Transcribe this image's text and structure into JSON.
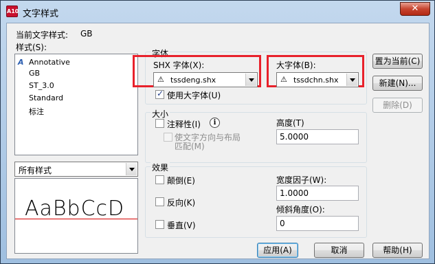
{
  "window": {
    "title": "文字样式",
    "app_icon_text": "A10",
    "close_glyph": "✕"
  },
  "current_style": {
    "label": "当前文字样式:",
    "value": "GB"
  },
  "styles": {
    "label": "样式(S):",
    "items": [
      {
        "icon": "A",
        "label": "Annotative"
      },
      {
        "label": "GB"
      },
      {
        "label": "ST_3.0"
      },
      {
        "label": "Standard"
      },
      {
        "label": "标注"
      }
    ],
    "filter": "所有样式"
  },
  "preview_text": "AaBbCcD",
  "font": {
    "group_title": "字体",
    "shx_label": "SHX 字体(X):",
    "shx_value": "tssdeng.shx",
    "big_label": "大字体(B):",
    "big_value": "tssdchn.shx",
    "use_big_font": "使用大字体(U)",
    "use_big_font_checked": true
  },
  "size": {
    "group_title": "大小",
    "annotative": "注释性(I)",
    "annotative_checked": false,
    "match_orientation_line1": "使文字方向与布局",
    "match_orientation_line2": "匹配(M)",
    "height_label": "高度(T)",
    "height_value": "5.0000"
  },
  "effects": {
    "group_title": "效果",
    "upside_down": "颠倒(E)",
    "backwards": "反向(K)",
    "vertical": "垂直(V)",
    "width_label": "宽度因子(W):",
    "width_value": "1.0000",
    "oblique_label": "倾斜角度(O):",
    "oblique_value": "0"
  },
  "buttons": {
    "set_current": "置为当前(C)",
    "new": "新建(N)...",
    "delete": "删除(D)",
    "apply": "应用(A)",
    "cancel": "取消",
    "help": "帮助(H)"
  },
  "colors": {
    "highlight": "#e8212b",
    "close_button": "#c7442f"
  }
}
